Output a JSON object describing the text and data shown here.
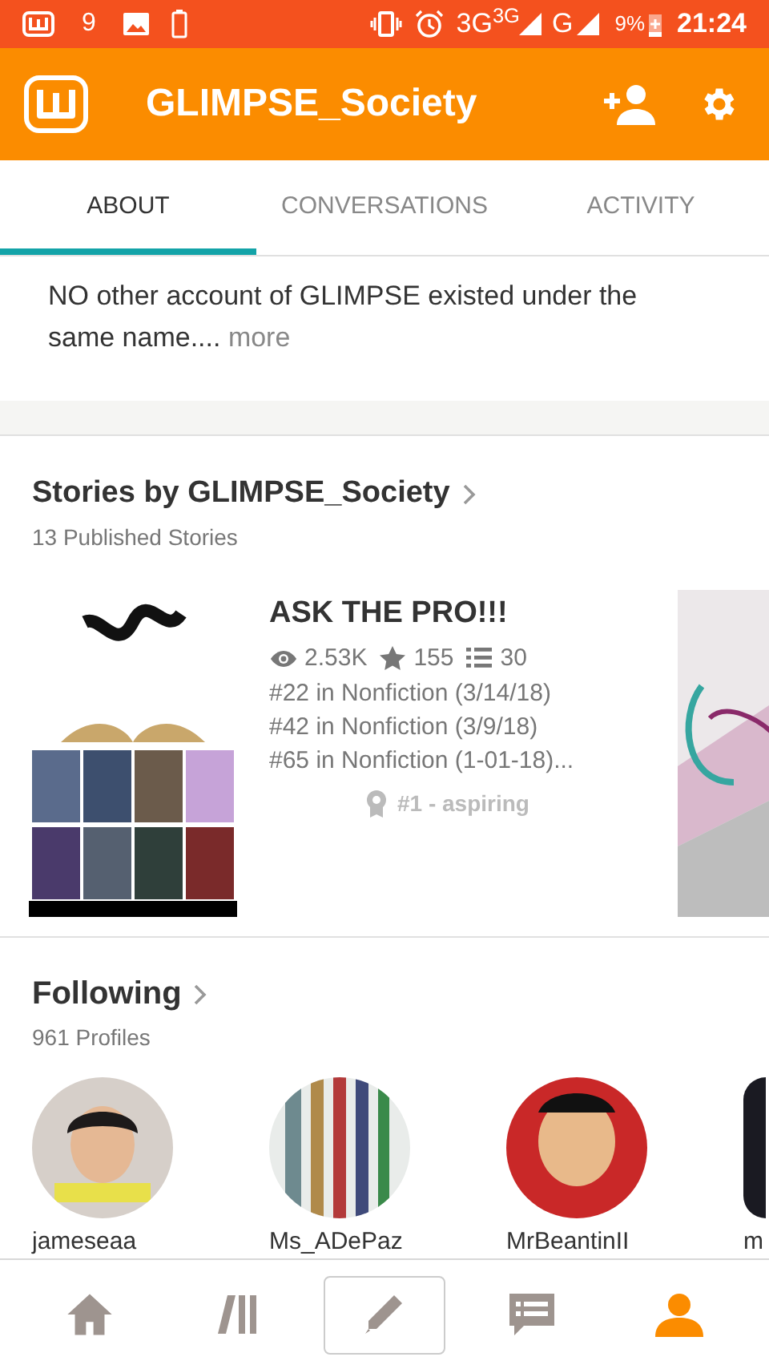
{
  "status_bar": {
    "notification_count": "9",
    "network": "3G$^{3G}$",
    "network_2": "G",
    "battery": "9%",
    "time": "21:24"
  },
  "header": {
    "title": "GLIMPSE_Society"
  },
  "tabs": [
    {
      "label": "ABOUT",
      "selected": true
    },
    {
      "label": "CONVERSATIONS",
      "selected": false
    },
    {
      "label": "ACTIVITY",
      "selected": false
    }
  ],
  "about": {
    "text": "NO other account of GLIMPSE existed under the same name....",
    "more": "more"
  },
  "stories": {
    "title": "Stories by GLIMPSE_Society",
    "count": "13 Published Stories",
    "items": [
      {
        "title": "ASK THE PRO!!!",
        "views": "2.53K",
        "votes": "155",
        "parts": "30",
        "ranks": [
          "#22 in Nonfiction (3/14/18)",
          "#42 in Nonfiction (3/9/18)",
          "#65 in Nonfiction (1-01-18)..."
        ],
        "badge": "#1 - aspiring"
      }
    ]
  },
  "following": {
    "title": "Following",
    "count": "961 Profiles",
    "profiles": [
      {
        "name": "jameseaa"
      },
      {
        "name": "Ms_ADePaz"
      },
      {
        "name": "MrBeantinII"
      },
      {
        "name": "m"
      }
    ]
  },
  "nav": [
    {
      "kind": "home",
      "selected": false
    },
    {
      "kind": "library",
      "selected": false
    },
    {
      "kind": "write",
      "selected": false
    },
    {
      "kind": "messages",
      "selected": false
    },
    {
      "kind": "profile",
      "selected": true
    }
  ]
}
